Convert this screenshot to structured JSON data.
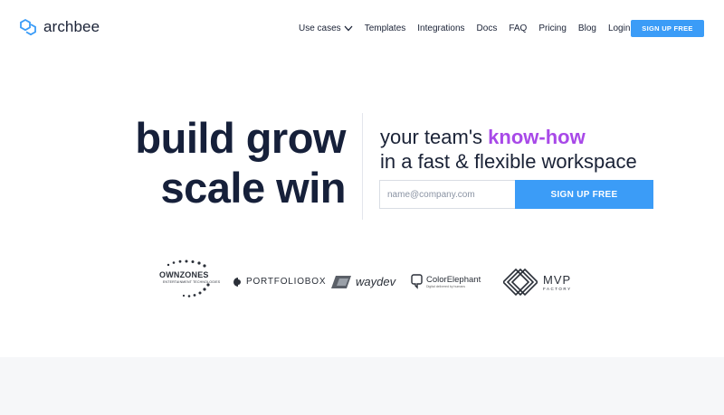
{
  "brand": {
    "name": "archbee",
    "accent": "#3b9cf7",
    "highlight": "#a849e8"
  },
  "nav": {
    "items": [
      {
        "label": "Use cases",
        "icon": "chevron-down-icon"
      },
      {
        "label": "Templates"
      },
      {
        "label": "Integrations"
      },
      {
        "label": "Docs"
      },
      {
        "label": "FAQ"
      },
      {
        "label": "Pricing"
      },
      {
        "label": "Blog"
      },
      {
        "label": "Login"
      }
    ],
    "cta": "SIGN UP FREE"
  },
  "hero": {
    "headline_line1": "build grow",
    "headline_line2": "scale win",
    "tagline_prefix": "your team's ",
    "tagline_highlight": "know-how",
    "tagline_line2": "in a fast & flexible workspace",
    "email_placeholder": "name@company.com",
    "cta": "SIGN UP FREE"
  },
  "logos": {
    "ownzones": {
      "name": "OWNZONES",
      "sub": "ENTERTAINMENT TECHNOLOGIES"
    },
    "portfoliobox": {
      "name": "PORTFOLIOBOX"
    },
    "waydev": {
      "name": "waydev"
    },
    "colorelephant": {
      "name": "ColorElephant",
      "sub": "Digital delivered by humans"
    },
    "mvp": {
      "name": "MVP",
      "sub": "FACTORY"
    }
  }
}
